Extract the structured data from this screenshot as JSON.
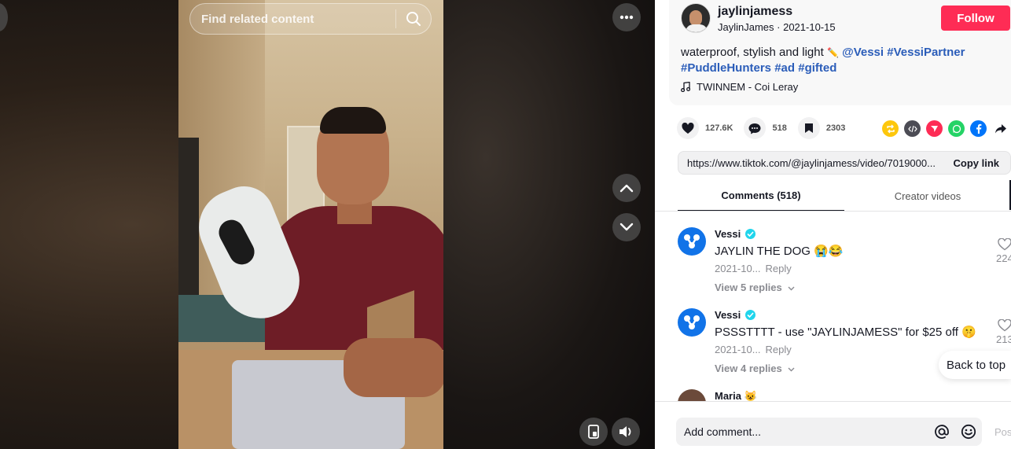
{
  "search": {
    "placeholder": "Find related content"
  },
  "video": {
    "more_icon": "ellipsis-icon",
    "up_icon": "chevron-up-icon",
    "down_icon": "chevron-down-icon",
    "pip_icon": "picture-in-picture-icon",
    "volume_icon": "volume-icon"
  },
  "author": {
    "username": "jaylinjamess",
    "nickname": "JaylinJames",
    "separator": " · ",
    "date": "2021-10-15",
    "follow_label": "Follow"
  },
  "description": {
    "text": "waterproof, stylish and light",
    "emoji": "✏️",
    "mention": "@Vessi",
    "tags": [
      "#VessiPartner",
      "#PuddleHunters",
      "#ad",
      "#gifted"
    ]
  },
  "music": {
    "title": "TWINNEM - Coi Leray"
  },
  "stats": {
    "likes": "127.6K",
    "comments": "518",
    "saves": "2303"
  },
  "share": {
    "link": "https://www.tiktok.com/@jaylinjamess/video/7019000...",
    "copy_label": "Copy link"
  },
  "tabs": {
    "comments": "Comments (518)",
    "creator_videos": "Creator videos"
  },
  "comments": [
    {
      "name": "Vessi",
      "text": "JAYLIN THE DOG 😭😂",
      "date": "2021-10...",
      "reply_label": "Reply",
      "view_replies": "View 5 replies",
      "likes": "224"
    },
    {
      "name": "Vessi",
      "text": "PSSSTTTT - use \"JAYLINJAMESS\" for $25 off 🤫",
      "date": "2021-10...",
      "reply_label": "Reply",
      "view_replies": "View 4 replies",
      "likes": "213"
    },
    {
      "name": "Maria 😺"
    }
  ],
  "back_to_top": "Back to top",
  "composer": {
    "placeholder": "Add comment...",
    "post_label": "Post"
  },
  "colors": {
    "follow": "#fe2c55",
    "hashtag": "#2b5db9",
    "verified": "#20d5ec",
    "vessi_blue": "#1173e8"
  }
}
